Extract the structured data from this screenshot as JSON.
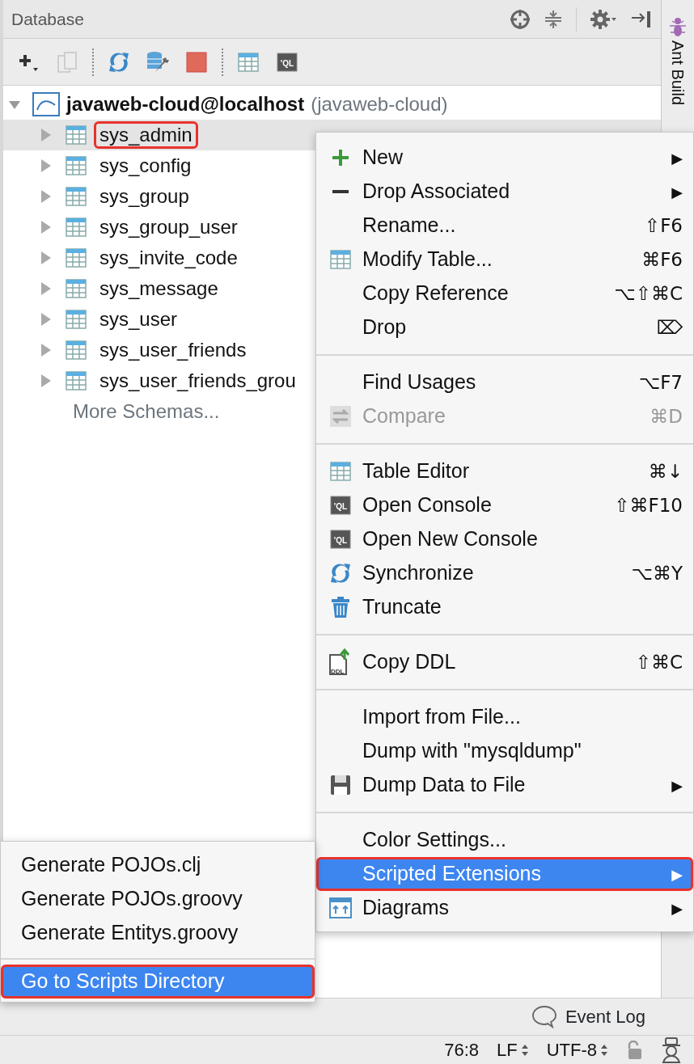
{
  "panel": {
    "title": "Database"
  },
  "toolbar": {
    "buttons": [
      {
        "disabled": false
      },
      {
        "disabled": true
      },
      {
        "disabled": false
      },
      {
        "disabled": false
      },
      {
        "disabled": false
      },
      {
        "disabled": false
      },
      {
        "disabled": false
      }
    ]
  },
  "tree": {
    "root": {
      "name": "javaweb-cloud@localhost",
      "detail": "(javaweb-cloud)",
      "expanded": true,
      "children": [
        {
          "name": "sys_admin",
          "selected": true,
          "annotated": true
        },
        {
          "name": "sys_config",
          "selected": false,
          "annotated": false
        },
        {
          "name": "sys_group",
          "selected": false,
          "annotated": false
        },
        {
          "name": "sys_group_user",
          "selected": false,
          "annotated": false
        },
        {
          "name": "sys_invite_code",
          "selected": false,
          "annotated": false
        },
        {
          "name": "sys_message",
          "selected": false,
          "annotated": false
        },
        {
          "name": "sys_user",
          "selected": false,
          "annotated": false
        },
        {
          "name": "sys_user_friends",
          "selected": false,
          "annotated": false
        },
        {
          "name": "sys_user_friends_grou",
          "selected": false,
          "annotated": false
        }
      ],
      "more": "More Schemas..."
    }
  },
  "side_tabs": [
    {
      "label": "Ant Build"
    }
  ],
  "context_menu": {
    "groups": [
      [
        {
          "label": "New",
          "submenu": true,
          "disabled": false,
          "selected": false,
          "annotated": false
        },
        {
          "label": "Drop Associated",
          "submenu": true,
          "disabled": false,
          "selected": false,
          "annotated": false
        },
        {
          "label": "Rename...",
          "shortcut": "⇧F6",
          "submenu": false,
          "disabled": false,
          "selected": false,
          "annotated": false
        },
        {
          "label": "Modify Table...",
          "shortcut": "⌘F6",
          "submenu": false,
          "disabled": false,
          "selected": false,
          "annotated": false
        },
        {
          "label": "Copy Reference",
          "shortcut": "⌥⇧⌘C",
          "submenu": false,
          "disabled": false,
          "selected": false,
          "annotated": false
        },
        {
          "label": "Drop",
          "shortcut": "⌦",
          "submenu": false,
          "disabled": false,
          "selected": false,
          "annotated": false
        }
      ],
      [
        {
          "label": "Find Usages",
          "shortcut": "⌥F7",
          "submenu": false,
          "disabled": false,
          "selected": false,
          "annotated": false
        },
        {
          "label": "Compare",
          "shortcut": "⌘D",
          "submenu": false,
          "disabled": true,
          "selected": false,
          "annotated": false
        }
      ],
      [
        {
          "label": "Table Editor",
          "shortcut": "⌘↓",
          "submenu": false,
          "disabled": false,
          "selected": false,
          "annotated": false
        },
        {
          "label": "Open Console",
          "shortcut": "⇧⌘F10",
          "submenu": false,
          "disabled": false,
          "selected": false,
          "annotated": false
        },
        {
          "label": "Open New Console",
          "submenu": false,
          "disabled": false,
          "selected": false,
          "annotated": false
        },
        {
          "label": "Synchronize",
          "shortcut": "⌥⌘Y",
          "submenu": false,
          "disabled": false,
          "selected": false,
          "annotated": false
        },
        {
          "label": "Truncate",
          "submenu": false,
          "disabled": false,
          "selected": false,
          "annotated": false
        }
      ],
      [
        {
          "label": "Copy DDL",
          "shortcut": "⇧⌘C",
          "submenu": false,
          "disabled": false,
          "selected": false,
          "annotated": false
        }
      ],
      [
        {
          "label": "Import from File...",
          "submenu": false,
          "disabled": false,
          "selected": false,
          "annotated": false
        },
        {
          "label": "Dump with \"mysqldump\"",
          "submenu": false,
          "disabled": false,
          "selected": false,
          "annotated": false
        },
        {
          "label": "Dump Data to File",
          "submenu": true,
          "disabled": false,
          "selected": false,
          "annotated": false
        }
      ],
      [
        {
          "label": "Color Settings...",
          "submenu": false,
          "disabled": false,
          "selected": false,
          "annotated": false
        },
        {
          "label": "Scripted Extensions",
          "submenu": true,
          "disabled": false,
          "selected": true,
          "annotated": true
        },
        {
          "label": "Diagrams",
          "submenu": true,
          "disabled": false,
          "selected": false,
          "annotated": false
        }
      ]
    ],
    "arrow": "▶"
  },
  "icon_labels": {
    "console": [
      "'QL",
      "'QL",
      "'QL"
    ],
    "ddl": "DDL"
  },
  "submenu": {
    "groups": [
      [
        {
          "label": "Generate POJOs.clj",
          "selected": false,
          "annotated": false
        },
        {
          "label": "Generate POJOs.groovy",
          "selected": false,
          "annotated": false
        },
        {
          "label": "Generate Entitys.groovy",
          "selected": false,
          "annotated": false
        }
      ],
      [
        {
          "label": "Go to Scripts Directory",
          "selected": true,
          "annotated": true
        }
      ]
    ]
  },
  "event_log": {
    "label": "Event Log"
  },
  "status_bar": {
    "position": "76:8",
    "line_separator": "LF",
    "encoding": "UTF-8"
  }
}
